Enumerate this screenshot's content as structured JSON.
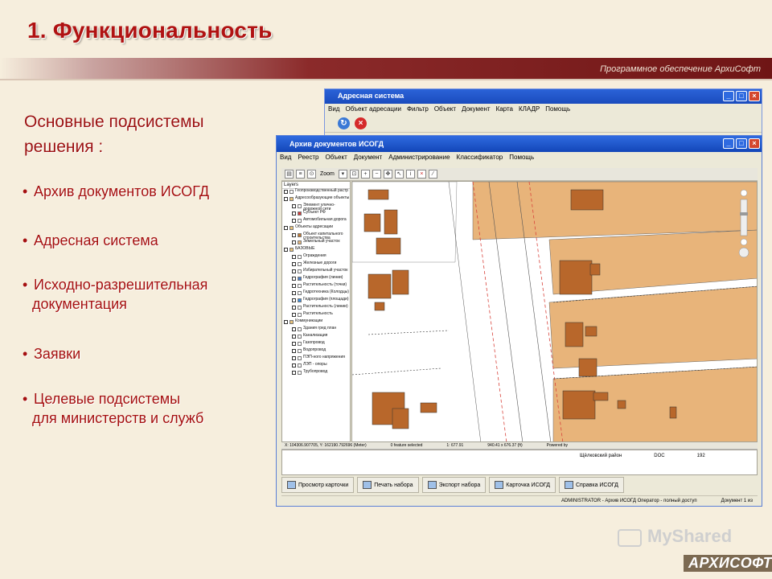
{
  "slide": {
    "title": "1. Функциональность",
    "subtitle": "Программное обеспечение АрхиСофт",
    "heading_line1": "Основные подсистемы",
    "heading_line2": "решения :",
    "bullets": [
      {
        "line1": "Архив документов ИСОГД",
        "line2": ""
      },
      {
        "line1": "Адресная система",
        "line2": ""
      },
      {
        "line1": "Исходно-разрешительная",
        "line2": "документация"
      },
      {
        "line1": "Заявки",
        "line2": ""
      },
      {
        "line1": "Целевые подсистемы",
        "line2": "для министерств и служб"
      }
    ]
  },
  "back_window": {
    "title": "Адресная система",
    "menu": [
      "Вид",
      "Объект адресации",
      "Фильтр",
      "Объект",
      "Документ",
      "Карта",
      "КЛАДР",
      "Помощь"
    ]
  },
  "front_window": {
    "title": "Архив документов ИСОГД",
    "menu": [
      "Вид",
      "Реестр",
      "Объект",
      "Документ",
      "Администрирование",
      "Классификатор",
      "Помощь"
    ],
    "zoom_label": "Zoom",
    "layers_title": "Layers",
    "layers": [
      {
        "label": "Геопроизводственный растр",
        "level": 1,
        "color": "#ffffff"
      },
      {
        "label": "Адресообразующие объекты",
        "level": 1,
        "color": "#e8c27a"
      },
      {
        "label": "Элемент улично-дорожной сети",
        "level": 2,
        "color": "#ffffff"
      },
      {
        "label": "Субъект РФ",
        "level": 2,
        "color": "#d33c3c"
      },
      {
        "label": "Автомобильная дорога",
        "level": 2,
        "color": "#ffffff"
      },
      {
        "label": "Объекты адресации",
        "level": 1,
        "color": "#e8c27a"
      },
      {
        "label": "Объект капитального строительства",
        "level": 2,
        "color": "#c07a35"
      },
      {
        "label": "Земельный участок",
        "level": 2,
        "color": "#e3b67c"
      },
      {
        "label": "БАЗОВЫЕ",
        "level": 1,
        "color": "#e8c27a"
      },
      {
        "label": "Ограждения",
        "level": 2,
        "color": "#ffffff"
      },
      {
        "label": "Железные дороги",
        "level": 2,
        "color": "#ffffff"
      },
      {
        "label": "Избирательный участок",
        "level": 2,
        "color": "#ffffff"
      },
      {
        "label": "Гидрография (линии)",
        "level": 2,
        "color": "#4a7ec7"
      },
      {
        "label": "Растительность (точки)",
        "level": 2,
        "color": "#ffffff"
      },
      {
        "label": "Гидротехника (Колодцы)",
        "level": 2,
        "color": "#ffffff"
      },
      {
        "label": "Гидрография (площади)",
        "level": 2,
        "color": "#3a8de0"
      },
      {
        "label": "Растительность (линии)",
        "level": 2,
        "color": "#ffffff"
      },
      {
        "label": "Растительность",
        "level": 2,
        "color": "#ffffff"
      },
      {
        "label": "Коммуникации",
        "level": 1,
        "color": "#e8c27a"
      },
      {
        "label": "Здания гред план",
        "level": 2,
        "color": "#ffffff"
      },
      {
        "label": "Канализация",
        "level": 2,
        "color": "#ffffff"
      },
      {
        "label": "Газопровод",
        "level": 2,
        "color": "#ffffff"
      },
      {
        "label": "Водопровод",
        "level": 2,
        "color": "#ffffff"
      },
      {
        "label": "ПЭП-ного напряжения",
        "level": 2,
        "color": "#ffffff"
      },
      {
        "label": "ЛЭП - опоры",
        "level": 2,
        "color": "#ffffff"
      },
      {
        "label": "Трубопровод",
        "level": 2,
        "color": "#ffffff"
      }
    ],
    "status": {
      "coords": "X: 104306.907705, Y: 162190.792696 (Meter)",
      "selected": "0 feature selected",
      "scale": "1: 677.91",
      "extent": "940.41 x 676.37 (ft)",
      "powered": "Powered by"
    },
    "grid_row": {
      "district": "Щёлковский район",
      "type": "DOC",
      "count": "192"
    },
    "buttons": [
      "Просмотр карточки",
      "Печать набора",
      "Экспорт набора",
      "Карточка ИСОГД",
      "Справка ИСОГД"
    ],
    "footer": {
      "user": "ADMINISTRATOR - Архив ИСОГД Оператор - полный доступ",
      "docs": "Документ 1 из"
    }
  },
  "watermark": {
    "site": "MyShared",
    "logo": "АРХИСОФТ"
  }
}
